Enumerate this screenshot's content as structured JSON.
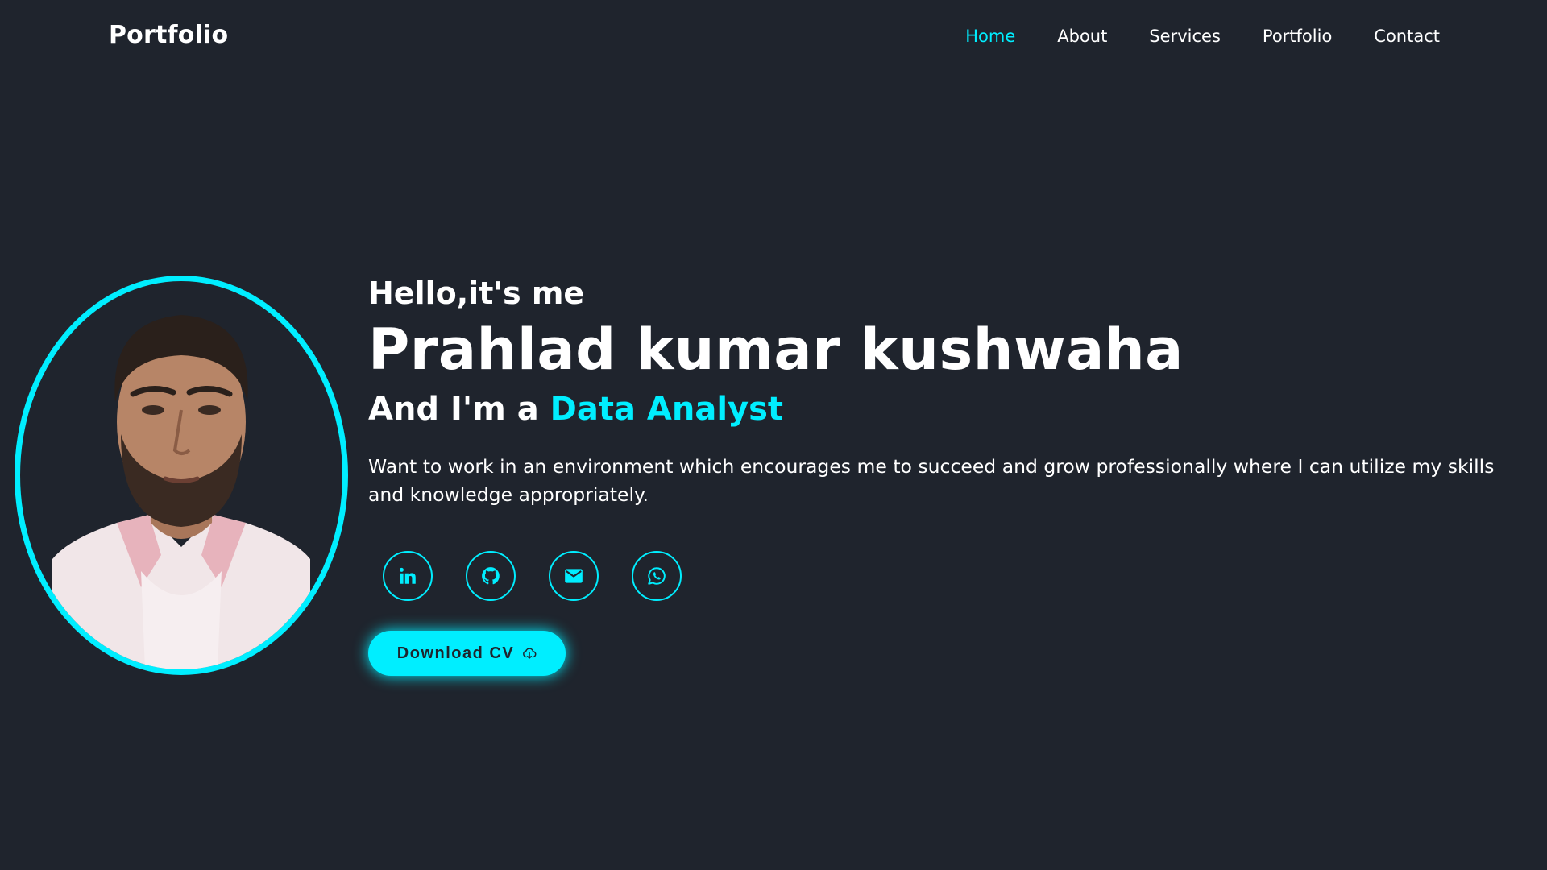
{
  "header": {
    "logo": "Portfolio",
    "nav": [
      {
        "label": "Home",
        "active": true
      },
      {
        "label": "About",
        "active": false
      },
      {
        "label": "Services",
        "active": false
      },
      {
        "label": "Portfolio",
        "active": false
      },
      {
        "label": "Contact",
        "active": false
      }
    ]
  },
  "hero": {
    "greeting": "Hello,it's me",
    "name": "Prahlad kumar kushwaha",
    "role_prefix": "And I'm a ",
    "role_highlight": "Data Analyst",
    "bio": "Want to work in an environment which encourages me to succeed and grow professionally where I can utilize my skills and knowledge appropriately.",
    "social": [
      {
        "icon": "linkedin-icon"
      },
      {
        "icon": "github-icon"
      },
      {
        "icon": "mail-icon"
      },
      {
        "icon": "whatsapp-icon"
      }
    ],
    "cta_label": "Download CV",
    "cta_icon": "cloud-download-icon"
  },
  "colors": {
    "background": "#1f242d",
    "accent": "#00eeff",
    "text": "#ffffff"
  }
}
